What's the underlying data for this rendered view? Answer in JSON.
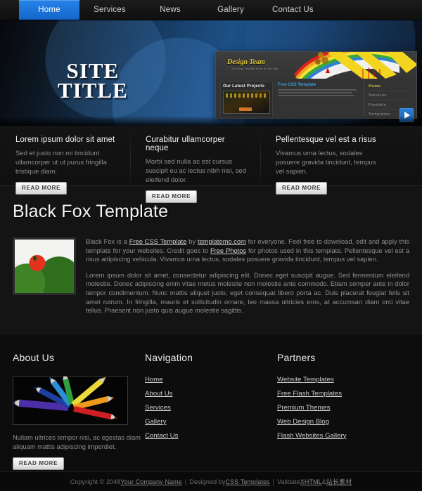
{
  "nav": {
    "items": [
      {
        "label": "Home",
        "active": true
      },
      {
        "label": "Services",
        "active": false
      },
      {
        "label": "News",
        "active": false
      },
      {
        "label": "Gallery",
        "active": false
      },
      {
        "label": "Contact Us",
        "active": false
      }
    ]
  },
  "hero": {
    "site_title": "SITE\nTITLE",
    "accent_color": "#1b6fd0",
    "banner_preview": {
      "logo": "Design Team",
      "tagline": "The most reliable team on the web",
      "panel_heading": "Our Latest Projects",
      "feature_link": "Free CSS Template",
      "feature_text": "Lorem ipsum dolor sit amet, consectetur adipiscing elit. Aliquam feugiat mi lacus, sed accumsan neque donec condimentum.",
      "menu": [
        {
          "label": "Home",
          "active": true
        },
        {
          "label": "Services",
          "active": false
        },
        {
          "label": "Portfolio",
          "active": false
        },
        {
          "label": "Templates",
          "active": false
        }
      ]
    },
    "play_button": "play-icon"
  },
  "teasers": [
    {
      "title": "Lorem ipsum dolor sit amet",
      "text": "Sed et justo non mi tincidunt ullamcorper ut ut purus fringilla tristique diam.",
      "button": "READ MORE"
    },
    {
      "title": "Curabitur ullamcorper neque",
      "text": "Morbi sed nulla ac est cursus suscipit eu ac lectus nibh nisi, sed eleifend dolor.",
      "button": "READ MORE"
    },
    {
      "title": "Pellentesque vel est a risus",
      "text": "Vivamus urna lectus, sodales posuere gravida tincidunt, tempus vel sapien.",
      "button": "READ MORE"
    }
  ],
  "main": {
    "heading": "Black Fox Template",
    "image_alt": "tomato-on-lettuce-photo",
    "paragraph1": {
      "a": "Black Fox is a ",
      "link1": "Free CSS Template",
      "b": " by ",
      "link2": "templatemo.com",
      "c": " for everyone. Feel free to download, edit and apply this template for your websites. Credit goes to ",
      "link3": "Free Photos",
      "d": " for photos used in this template. Pellentesque vel est a risus adipiscing vehicula. Vivamus urna lectus, sodales posuere gravida tincidunt, tempus vel sapien."
    },
    "paragraph2": "Lorem ipsum dolor sit amet, consectetur adipiscing elit. Donec eget suscipit augue. Sed fermentum eleifend molestie. Donec adipiscing enim vitae metus molestie non molestie ante commodo. Etiam semper ante in dolor tempor condimentum. Nunc mattis aliquet justo, eget consequat libero porta ac. Duis placerat feugiat felis sit amet rutrum. In fringilla, mauris et sollicitudin ornare, leo massa ultricies eros, at accumsan diam orci vitae tellus. Praesent non justo quis augue molestie sagittis."
  },
  "footer": {
    "about": {
      "heading": "About Us",
      "image_alt": "colored-pencils-photo",
      "text": "Nullam ultrices tempor nisi, ac egestas diam aliquam mattis adipiscing imperdiet.",
      "button": "READ MORE"
    },
    "navigation": {
      "heading": "Navigation",
      "links": [
        "Home",
        "About Us",
        "Services",
        "Gallery",
        "Contact Us"
      ]
    },
    "partners": {
      "heading": "Partners",
      "links": [
        "Website Templates",
        "Free Flash Templates",
        "Premium Themes",
        "Web Design Blog",
        "Flash Websites Gallery"
      ]
    }
  },
  "copyright": {
    "prefix": "Copyright © 2048 ",
    "company_link": "Your Company Name",
    "mid": " Designed by ",
    "css_link": "CSS Templates",
    "validate": " Validate ",
    "xhtml_link": "XHTML",
    "amp": " & ",
    "cn_link": "站长素材",
    "separator": "|"
  }
}
